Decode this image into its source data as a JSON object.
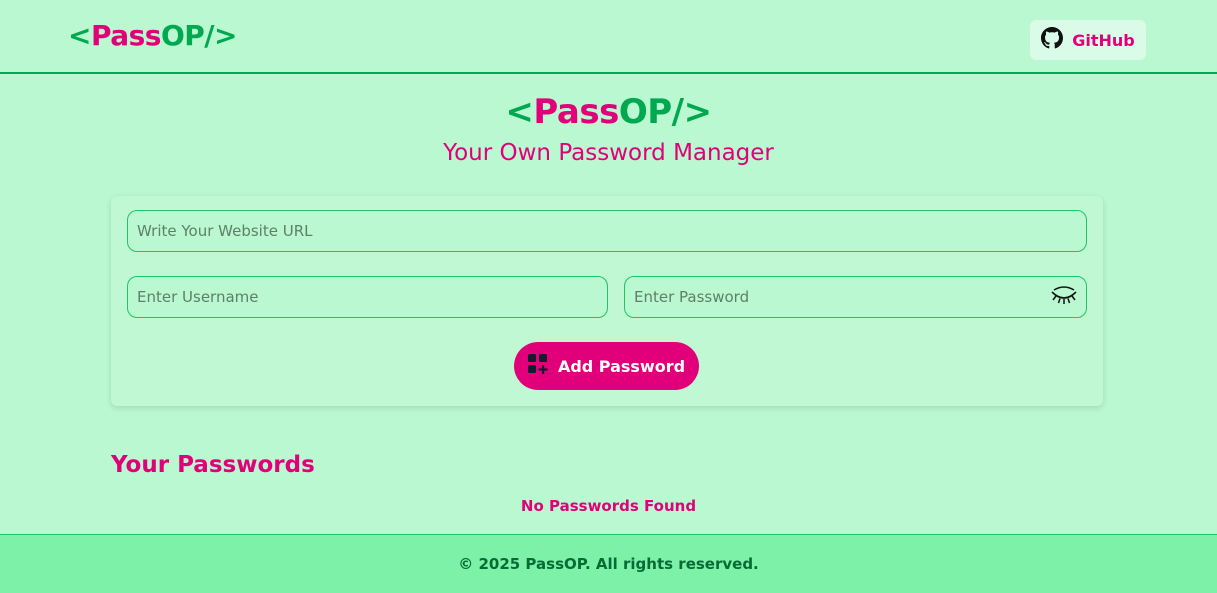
{
  "navbar": {
    "logo": {
      "open": "<",
      "pass": "Pass",
      "op": "OP/>"
    },
    "github": {
      "label": "GitHub",
      "icon": "github-icon"
    }
  },
  "hero": {
    "logo": {
      "open": "<",
      "pass": "Pass",
      "op": "OP/>"
    },
    "subtitle": "Your Own Password Manager"
  },
  "form": {
    "url_placeholder": "Write Your Website URL",
    "url_value": "",
    "username_placeholder": "Enter Username",
    "username_value": "",
    "password_placeholder": "Enter Password",
    "password_value": "",
    "toggle_icon": "eye-closed-icon",
    "add_button": {
      "label": "Add Password",
      "icon": "add-grid-icon"
    }
  },
  "passwords": {
    "title": "Your Passwords",
    "empty_message": "No Passwords Found"
  },
  "footer": {
    "text": "© 2025 PassOP. All rights reserved."
  },
  "colors": {
    "background": "#b9f8d0",
    "accent_pink": "#e2007a",
    "accent_green": "#00a84f",
    "footer_bg": "#7df1a8",
    "footer_text": "#066c36"
  }
}
